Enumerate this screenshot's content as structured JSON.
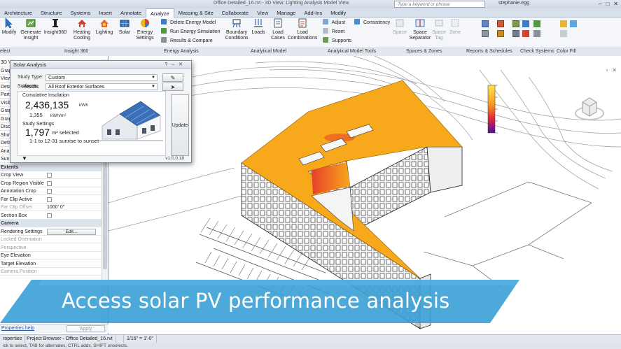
{
  "window": {
    "title": "Office Detailed_16.rvt - 3D View: Lighting Analysis Model View"
  },
  "search": {
    "placeholder": "Type a keyword or phrase"
  },
  "user": {
    "name": "stephanie.egg"
  },
  "tabs": [
    "Architecture",
    "Structure",
    "Systems",
    "Insert",
    "Annotate",
    "Analyze",
    "Massing & Site",
    "Collaborate",
    "View",
    "Manage",
    "Add-Ins",
    "Modify"
  ],
  "active_tab": "Analyze",
  "ribbon": {
    "modify": "Modify",
    "select": "elect",
    "generate_insight": "Generate Insight",
    "insight360": "Insight360",
    "heating_cooling": "Heating Cooling",
    "lighting": "Lighting",
    "solar": "Solar",
    "energy_settings": "Energy Settings",
    "delete_energy_model": "Delete Energy Model",
    "run_energy_simulation": "Run Energy Simulation",
    "results_compare": "Results & Compare",
    "boundary_conditions": "Boundary Conditions",
    "loads": "Loads",
    "load_cases": "Load Cases",
    "load_combinations": "Load Combinations",
    "adjust": "Adjust",
    "reset": "Reset",
    "supports": "Supports",
    "consistency": "Consistency",
    "space": "Space",
    "space_separator": "Space Separator",
    "space_tag": "Space Tag",
    "zone": "Zone",
    "panels": {
      "insight360": "Insight 360",
      "energy_analysis": "Energy Analysis",
      "analytical_model": "Analytical Model",
      "analytical_model_tools": "Analytical Model Tools",
      "spaces_zones": "Spaces & Zones",
      "reports_schedules": "Reports & Schedules",
      "check_systems": "Check Systems",
      "color_fill": "Color Fill"
    }
  },
  "properties": {
    "rows": [
      {
        "key": "3D Vie",
        "value": "",
        "type": "text"
      },
      {
        "key": "Grap",
        "value": "",
        "type": "text"
      },
      {
        "key": "View",
        "value": "",
        "type": "text"
      },
      {
        "key": "Deta",
        "value": "",
        "type": "text"
      },
      {
        "key": "Parts",
        "value": "",
        "type": "text"
      },
      {
        "key": "Visib",
        "value": "",
        "type": "text"
      },
      {
        "key": "Grap",
        "value": "",
        "type": "text"
      },
      {
        "key": "Graphic Display Opt...",
        "value": "Edit...",
        "type": "button"
      },
      {
        "key": "Discipline",
        "value": "Coordination",
        "type": "text"
      },
      {
        "key": "Show Hidden Lines",
        "value": "By Discipline",
        "type": "text"
      },
      {
        "key": "Default Analysis Di...",
        "value": "Solar Analysis Def...",
        "type": "text"
      },
      {
        "key": "Analysis Display Se...",
        "value": "Edit...",
        "type": "button"
      },
      {
        "key": "Sun Path",
        "value": "",
        "type": "check"
      },
      {
        "key": "Extents",
        "value": "",
        "type": "section"
      },
      {
        "key": "Crop View",
        "value": "",
        "type": "check"
      },
      {
        "key": "Crop Region Visible",
        "value": "",
        "type": "check"
      },
      {
        "key": "Annotation Crop",
        "value": "",
        "type": "check"
      },
      {
        "key": "Far Clip Active",
        "value": "",
        "type": "check"
      },
      {
        "key": "Far Clip Offset",
        "value": "1000' 0\"",
        "type": "grey"
      },
      {
        "key": "Section Box",
        "value": "",
        "type": "check"
      },
      {
        "key": "Camera",
        "value": "",
        "type": "section"
      },
      {
        "key": "Rendering Settings",
        "value": "Edit...",
        "type": "button"
      },
      {
        "key": "Locked Orientation",
        "value": "",
        "type": "grey"
      },
      {
        "key": "Perspective",
        "value": "",
        "type": "grey"
      },
      {
        "key": "Eye Elevation",
        "value": "",
        "type": "text"
      },
      {
        "key": "Target Elevation",
        "value": "",
        "type": "text"
      },
      {
        "key": "Camera Position",
        "value": "",
        "type": "grey"
      }
    ],
    "help": "Properties help",
    "apply": "Apply"
  },
  "browser_tabs": {
    "properties": "roperties",
    "project_browser": "Project Browser - Office Detailed_16.rvt"
  },
  "view_scale": "1/16\" = 1'-0\"",
  "status_text": "ick to select, TAB for alternates, CTRL adds, SHIFT unselects.",
  "dialog": {
    "title": "Solar Analysis",
    "study_type_label": "Study Type:",
    "study_type_value": "Custom",
    "surfaces_label": "Surfaces:",
    "surfaces_value": "All Roof Exterior Surfaces",
    "results_label": "Results",
    "cumulative_label": "Cumulative Insolation",
    "cumulative_value": "2,436,135",
    "cumulative_unit": "kWh",
    "per_area_value": "1,355",
    "per_area_unit": "kWh/m²",
    "study_settings_label": "Study Settings",
    "selected_value": "1,797",
    "selected_unit": "m² selected",
    "date_range": "1-1 to 12-31 sunrise to sunset",
    "update_label": "Update",
    "version": "v1.0.0.18"
  },
  "banner": {
    "text": "Access solar PV performance analysis"
  },
  "colors": {
    "roof_orange": "#f7a81b",
    "banner_blue": "#3aa0d6",
    "heat_red": "#e8402a",
    "legend_yellow": "#ffe44a",
    "legend_purple": "#4b0fa8"
  }
}
